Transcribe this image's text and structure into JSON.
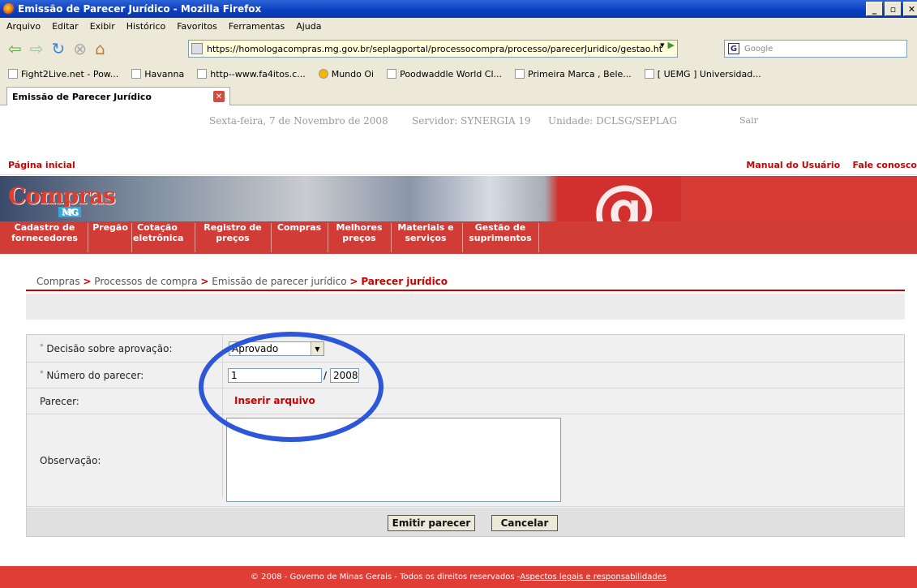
{
  "window": {
    "title": "Emissão de Parecer Jurídico - Mozilla Firefox"
  },
  "menu": [
    "Arquivo",
    "Editar",
    "Exibir",
    "Histórico",
    "Favoritos",
    "Ferramentas",
    "Ajuda"
  ],
  "url": "https://homologacompras.mg.gov.br/seplagportal/processocompra/processo/parecerJuridico/gestao.ht",
  "search": {
    "placeholder": "Google"
  },
  "bookmarks": [
    "Fight2Live.net - Pow...",
    "Havanna",
    "http--www.fa4itos.c...",
    "Mundo Oi",
    "Poodwaddle World Cl...",
    "Primeira Marca , Bele...",
    "[ UEMG ] Universidad..."
  ],
  "tab": {
    "title": "Emissão de Parecer Jurídico"
  },
  "info": {
    "date": "Sexta-feira, 7 de Novembro de 2008",
    "server": "Servidor: SYNERGIA 19",
    "unit": "Unidade: DCLSG/SEPLAG",
    "logout": "Sair"
  },
  "links": {
    "home": "Página inicial",
    "manual": "Manual do Usuário",
    "contact": "Fale conosco"
  },
  "logo": {
    "text": "Compras",
    "sub": "MG"
  },
  "nav": [
    {
      "l1": "Cadastro de",
      "l2": "fornecedores"
    },
    {
      "l1": "Pregão",
      "l2": ""
    },
    {
      "l1": "Cotação",
      "l2": "eletrônica"
    },
    {
      "l1": "Registro de",
      "l2": "preços"
    },
    {
      "l1": "Compras",
      "l2": ""
    },
    {
      "l1": "Melhores",
      "l2": "preços"
    },
    {
      "l1": "Materiais e",
      "l2": "serviços"
    },
    {
      "l1": "Gestão de",
      "l2": "suprimentos"
    }
  ],
  "breadcrumb": {
    "c1": "Compras",
    "c2": "Processos de compra",
    "c3": "Emissão de parecer jurídico",
    "current": "Parecer jurídico",
    "sep": ">"
  },
  "form": {
    "decision_label": "Decisão sobre aprovação:",
    "decision_value": "Aprovado",
    "number_label": "Número do parecer:",
    "number_value": "1",
    "year_value": "2008",
    "number_sep": "/",
    "parecer_label": "Parecer:",
    "insert_file": "Inserir arquivo",
    "obs_label": "Observação:",
    "required_mark": "*",
    "submit": "Emitir parecer",
    "cancel": "Cancelar"
  },
  "footer": {
    "text": "© 2008 - Governo de Minas Gerais - Todos os direitos reservados - ",
    "link": "Aspectos legais e responsabilidades"
  },
  "colors": {
    "accent": "#d23c37",
    "highlight_ellipse": "#2c57d8",
    "link": "#cc0000"
  },
  "icons": [
    "firefox-logo-icon",
    "back-icon",
    "forward-icon",
    "reload-icon",
    "stop-icon",
    "home-icon",
    "tab-close-icon",
    "select-arrow-icon"
  ]
}
